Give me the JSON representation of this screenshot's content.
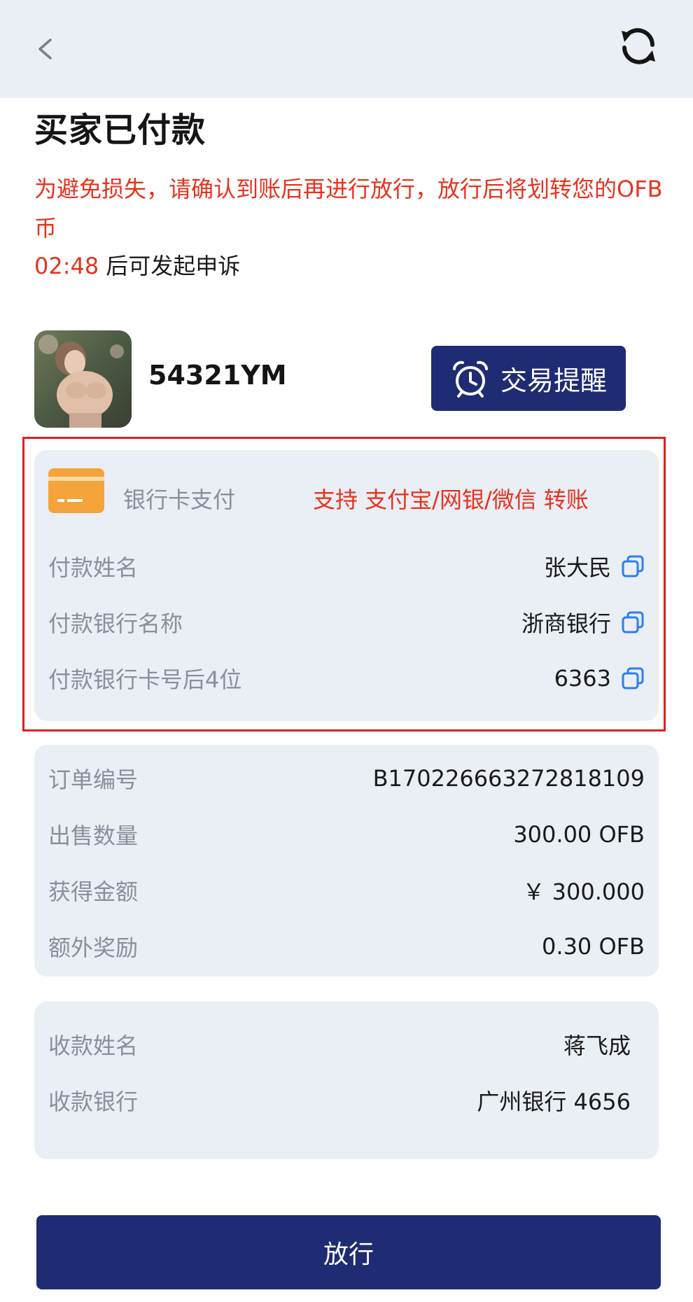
{
  "header": {
    "back_icon": "chevron-left-icon",
    "refresh_icon": "refresh-icon"
  },
  "title": "买家已付款",
  "warning": "为避免损失，请确认到账后再进行放行，放行后将划转您的OFB币",
  "appeal": {
    "timer": "02:48",
    "text": "后可发起申诉"
  },
  "counterparty": {
    "username": "54321YM",
    "remind_label": "交易提醒",
    "remind_icon": "alarm-clock-icon"
  },
  "payment": {
    "method_icon": "bank-card-icon",
    "method_label": "银行卡支付",
    "support_text": "支持 支付宝/网银/微信 转账",
    "rows": [
      {
        "label": "付款姓名",
        "value": "张大民"
      },
      {
        "label": "付款银行名称",
        "value": "浙商银行"
      },
      {
        "label": "付款银行卡号后4位",
        "value": "6363"
      }
    ]
  },
  "order": {
    "rows": [
      {
        "label": "订单编号",
        "value": "B170226663272818109"
      },
      {
        "label": "出售数量",
        "value": "300.00 OFB"
      },
      {
        "label": "获得金额",
        "value": "￥ 300.000"
      },
      {
        "label": "额外奖励",
        "value": "0.30 OFB"
      }
    ]
  },
  "receive": {
    "rows": [
      {
        "label": "收款姓名",
        "value": "蒋飞成"
      },
      {
        "label": "收款银行",
        "value": "广州银行 4656"
      }
    ]
  },
  "release_label": "放行",
  "colors": {
    "accent_red": "#e8321e",
    "navy": "#1f2b72",
    "card_bg": "#eaeef5",
    "copy_blue": "#2f7bf6",
    "bank_card_orange": "#f4a43b"
  }
}
